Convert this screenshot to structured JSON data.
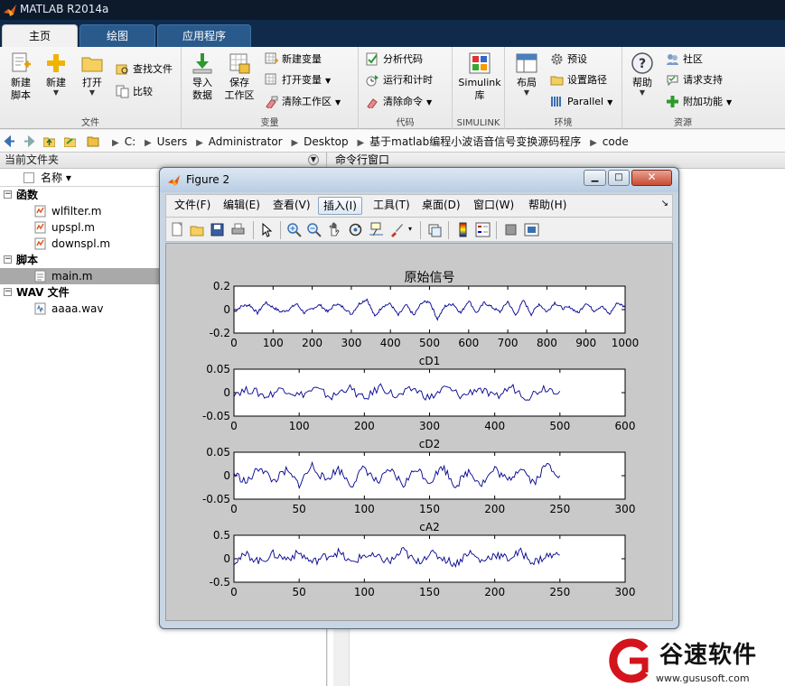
{
  "app": {
    "title": "MATLAB R2014a"
  },
  "ribbon": {
    "tabs": [
      {
        "label": "主页",
        "active": true
      },
      {
        "label": "绘图",
        "active": false
      },
      {
        "label": "应用程序",
        "active": false
      }
    ],
    "file_section": {
      "label": "文件",
      "new_script": "新建\n脚本",
      "new": "新建",
      "open": "打开",
      "find_files": "查找文件",
      "compare": "比较"
    },
    "variable_section": {
      "label": "变量",
      "import_data": "导入\n数据",
      "save_workspace": "保存\n工作区",
      "new_variable": "新建变量",
      "open_variable": "打开变量",
      "clear_workspace": "清除工作区"
    },
    "code_section": {
      "label": "代码",
      "analyze_code": "分析代码",
      "run_and_time": "运行和计时",
      "clear_commands": "清除命令"
    },
    "simulink_section": {
      "label": "SIMULINK",
      "simulink_library": "Simulink\n库"
    },
    "environment_section": {
      "label": "环境",
      "layout": "布局",
      "preferences": "预设",
      "set_path": "设置路径",
      "parallel": "Parallel"
    },
    "resources_section": {
      "label": "资源",
      "help": "帮助",
      "community": "社区",
      "request_support": "请求支持",
      "add_ons": "附加功能"
    }
  },
  "address": {
    "crumbs": [
      "C:",
      "Users",
      "Administrator",
      "Desktop",
      "基于matlab编程小波语音信号变换源码程序",
      "code"
    ]
  },
  "folder_panel": {
    "title": "当前文件夹",
    "column_name": "名称 ▾",
    "groups": [
      {
        "label": "函数",
        "items": [
          "wlfilter.m",
          "upspl.m",
          "downspl.m"
        ]
      },
      {
        "label": "脚本",
        "items": [
          "main.m"
        ]
      },
      {
        "label": "WAV 文件",
        "items": [
          "aaaa.wav"
        ]
      }
    ],
    "selected_item": "main.m"
  },
  "command_window": {
    "title": "命令行窗口"
  },
  "figure": {
    "title": "Figure 2",
    "menu": [
      "文件(F)",
      "编辑(E)",
      "查看(V)",
      "插入(I)",
      "工具(T)",
      "桌面(D)",
      "窗口(W)",
      "帮助(H)"
    ],
    "hover_menu": "插入(I)",
    "toolbar_icons": [
      "new-figure-icon",
      "open-file-icon",
      "save-icon",
      "print-icon",
      "pointer-icon",
      "zoom-in-icon",
      "zoom-out-icon",
      "pan-icon",
      "rotate-icon",
      "data-cursor-icon",
      "brush-icon",
      "link-plot-icon",
      "colorbar-icon",
      "legend-icon",
      "hide-plot-tools-icon",
      "show-plot-tools-icon"
    ]
  },
  "chart_data": [
    {
      "type": "line",
      "title": "原始信号",
      "xlabel": "",
      "ylabel": "",
      "xlim": [
        0,
        1000
      ],
      "ylim": [
        -0.2,
        0.2
      ],
      "xticks": [
        0,
        100,
        200,
        300,
        400,
        500,
        600,
        700,
        800,
        900,
        1000
      ],
      "yticks": [
        "0.2",
        "0",
        "-0.2"
      ],
      "grid": false,
      "color": "#00008f",
      "series": [
        {
          "x": [
            0,
            20,
            40,
            60,
            80,
            100,
            120,
            140,
            160,
            180,
            200,
            220,
            240,
            260,
            280,
            300,
            320,
            340,
            360,
            380,
            400,
            420,
            440,
            460,
            480,
            500,
            520,
            540,
            560,
            580,
            600,
            620,
            640,
            660,
            680,
            700,
            720,
            740,
            760,
            780,
            800,
            820,
            840,
            860,
            880,
            900,
            920,
            940,
            960,
            980,
            1000
          ],
          "values": [
            -0.02,
            0.03,
            0.04,
            -0.03,
            0.06,
            0.02,
            -0.02,
            0.0,
            0.05,
            -0.03,
            0.01,
            0.04,
            -0.02,
            0.05,
            0.02,
            -0.04,
            0.05,
            0.09,
            -0.06,
            0.03,
            0.05,
            -0.05,
            0.04,
            -0.05,
            0.06,
            0.07,
            -0.08,
            0.03,
            0.05,
            -0.03,
            0.08,
            -0.03,
            0.06,
            0.02,
            -0.02,
            0.07,
            -0.05,
            0.08,
            -0.04,
            0.05,
            -0.02,
            0.06,
            0.01,
            0.02,
            -0.03,
            0.06,
            -0.01,
            0.03,
            -0.04,
            0.06,
            0.02
          ]
        }
      ]
    },
    {
      "type": "line",
      "title": "cD1",
      "xlim": [
        0,
        600
      ],
      "ylim": [
        -0.05,
        0.05
      ],
      "xticks": [
        0,
        100,
        200,
        300,
        400,
        500,
        600
      ],
      "yticks": [
        "0.05",
        "0",
        "-0.05"
      ],
      "grid": false,
      "color": "#00008f",
      "series": [
        {
          "x": [
            0,
            25,
            50,
            75,
            100,
            125,
            150,
            175,
            200,
            225,
            250,
            275,
            300,
            325,
            350,
            375,
            400,
            425,
            450,
            475,
            500
          ],
          "values": [
            0.0,
            0.006,
            -0.008,
            0.01,
            -0.006,
            0.008,
            -0.01,
            0.012,
            -0.015,
            0.014,
            -0.01,
            0.009,
            -0.012,
            0.011,
            -0.008,
            0.01,
            -0.012,
            0.013,
            -0.01,
            0.011,
            0.003
          ]
        }
      ]
    },
    {
      "type": "line",
      "title": "cD2",
      "xlim": [
        0,
        300
      ],
      "ylim": [
        -0.05,
        0.05
      ],
      "xticks": [
        0,
        50,
        100,
        150,
        200,
        250,
        300
      ],
      "yticks": [
        "0.05",
        "0",
        "-0.05"
      ],
      "grid": false,
      "color": "#00008f",
      "series": [
        {
          "x": [
            0,
            10,
            20,
            30,
            40,
            50,
            60,
            70,
            80,
            90,
            100,
            110,
            120,
            130,
            140,
            150,
            160,
            170,
            180,
            190,
            200,
            210,
            220,
            230,
            240,
            250
          ],
          "values": [
            0.005,
            -0.015,
            0.02,
            -0.012,
            0.01,
            -0.018,
            0.022,
            -0.01,
            0.015,
            -0.02,
            0.018,
            -0.016,
            0.012,
            -0.02,
            0.017,
            -0.014,
            0.02,
            -0.022,
            0.01,
            -0.018,
            0.015,
            -0.012,
            0.02,
            -0.016,
            0.025,
            0.0
          ]
        }
      ]
    },
    {
      "type": "line",
      "title": "cA2",
      "xlim": [
        0,
        300
      ],
      "ylim": [
        -0.5,
        0.5
      ],
      "xticks": [
        0,
        50,
        100,
        150,
        200,
        250,
        300
      ],
      "yticks": [
        "0.5",
        "0",
        "-0.5"
      ],
      "grid": false,
      "color": "#00008f",
      "series": [
        {
          "x": [
            0,
            10,
            20,
            30,
            40,
            50,
            60,
            70,
            80,
            90,
            100,
            110,
            120,
            130,
            140,
            150,
            160,
            170,
            180,
            190,
            200,
            210,
            220,
            230,
            240,
            250
          ],
          "values": [
            -0.05,
            0.08,
            -0.06,
            0.1,
            0.0,
            0.12,
            -0.08,
            0.05,
            0.14,
            -0.1,
            0.08,
            0.02,
            -0.06,
            0.18,
            -0.1,
            0.12,
            0.02,
            -0.12,
            0.15,
            -0.06,
            0.1,
            0.0,
            0.14,
            -0.08,
            0.06,
            0.08
          ]
        }
      ]
    }
  ],
  "watermark": {
    "brand": "谷速软件",
    "url": "www.gususoft.com"
  }
}
